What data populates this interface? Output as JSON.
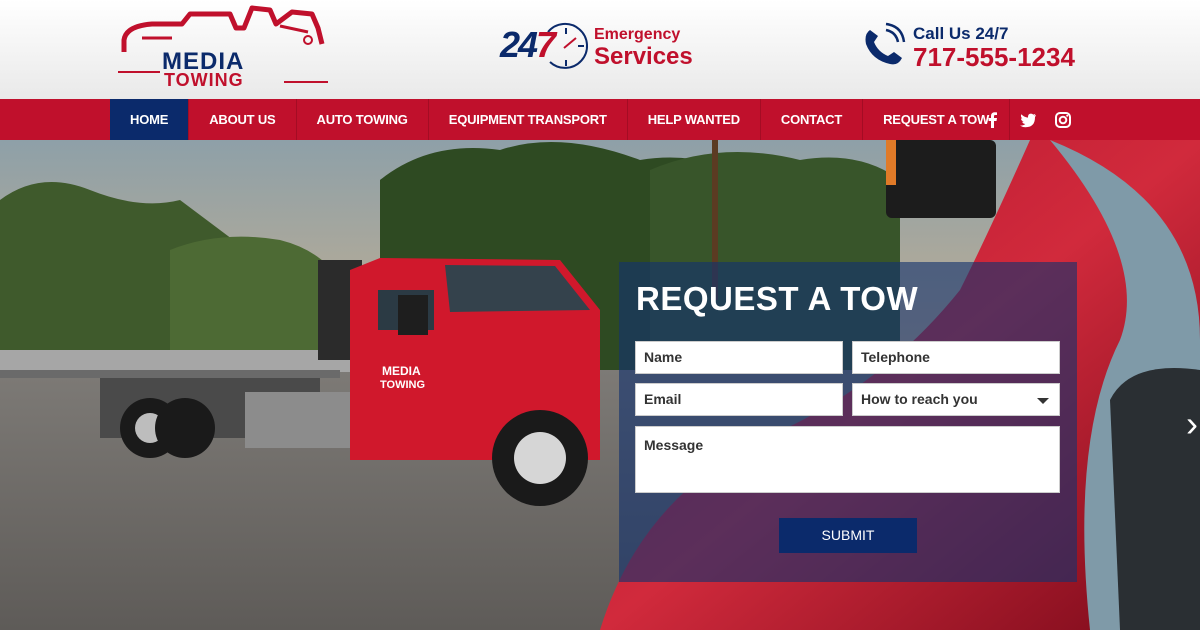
{
  "logo": {
    "line1": "MEDIA",
    "line2": "TOWING"
  },
  "emergency": {
    "badge_left": "24",
    "badge_right": "7",
    "line1": "Emergency",
    "line2": "Services"
  },
  "contact": {
    "line1": "Call Us 24/7",
    "phone": "717-555-1234"
  },
  "nav": {
    "items": [
      {
        "label": "HOME",
        "active": true
      },
      {
        "label": "ABOUT US"
      },
      {
        "label": "AUTO TOWING"
      },
      {
        "label": "EQUIPMENT TRANSPORT"
      },
      {
        "label": "HELP WANTED"
      },
      {
        "label": "CONTACT"
      },
      {
        "label": "REQUEST A TOW"
      }
    ],
    "social": [
      "facebook-icon",
      "twitter-icon",
      "instagram-icon"
    ]
  },
  "hero": {
    "truck_logo_line1": "MEDIA",
    "truck_logo_line2": "TOWING"
  },
  "form": {
    "title": "REQUEST A TOW",
    "name_placeholder": "Name",
    "telephone_placeholder": "Telephone",
    "email_placeholder": "Email",
    "reach_selected": "How to reach you",
    "message_placeholder": "Message",
    "submit_label": "SUBMIT"
  },
  "colors": {
    "brand_red": "#c0102c",
    "brand_navy": "#0b2a6b"
  }
}
